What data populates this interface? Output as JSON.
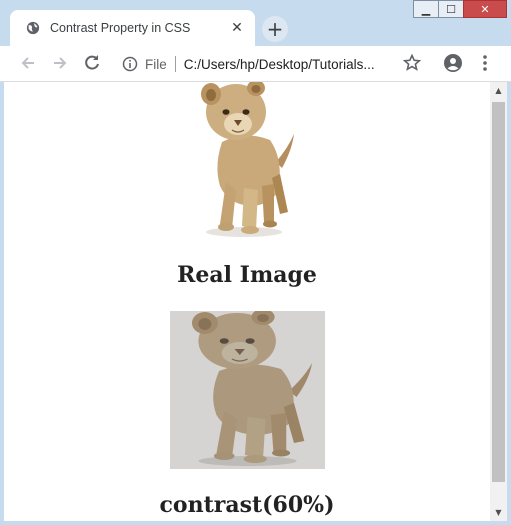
{
  "window": {
    "controls": {
      "minimize": "▁",
      "maximize": "☐",
      "close": "✕"
    }
  },
  "tab": {
    "title": "Contrast Property in CSS",
    "close_glyph": "✕",
    "icon": "globe-icon"
  },
  "new_tab": {
    "glyph": "+"
  },
  "toolbar": {
    "back_icon": "back-arrow-icon",
    "forward_icon": "forward-arrow-icon",
    "reload_icon": "reload-icon",
    "scheme_label": "File",
    "url": "C:/Users/hp/Desktop/Tutorials...",
    "bookmark_icon": "star-icon",
    "profile_icon": "account-icon",
    "menu_icon": "kebab-menu-icon"
  },
  "page": {
    "images": [
      {
        "caption": "Real Image",
        "alt": "lion cub",
        "contrast_percent": 100
      },
      {
        "caption": "contrast(60%)",
        "alt": "lion cub",
        "contrast_percent": 60
      }
    ]
  },
  "colors": {
    "chrome_frame": "#c7dbef",
    "page_bg": "#ffffff",
    "caption_text": "#222222"
  }
}
